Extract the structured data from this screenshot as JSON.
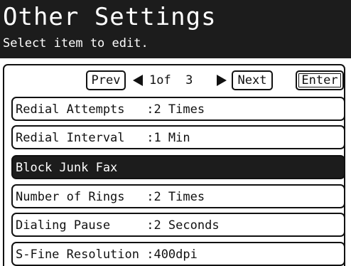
{
  "screen": {
    "title": "Other Settings",
    "subtitle": "Select item to edit."
  },
  "navigation": {
    "prev_label": "Prev",
    "next_label": "Next",
    "enter_label": "Enter",
    "page_text": "1of  3"
  },
  "items": [
    {
      "label": "Redial Attempts   :2 Times",
      "selected": false
    },
    {
      "label": "Redial Interval   :1 Min",
      "selected": false
    },
    {
      "label": "Block Junk Fax",
      "selected": true
    },
    {
      "label": "Number of Rings   :2 Times",
      "selected": false
    },
    {
      "label": "Dialing Pause     :2 Seconds",
      "selected": false
    },
    {
      "label": "S-Fine Resolution :400dpi",
      "selected": false
    }
  ],
  "colors": {
    "header_bg": "#1c1c1c",
    "selected_bg": "#1c1c1c",
    "text": "#111111"
  }
}
